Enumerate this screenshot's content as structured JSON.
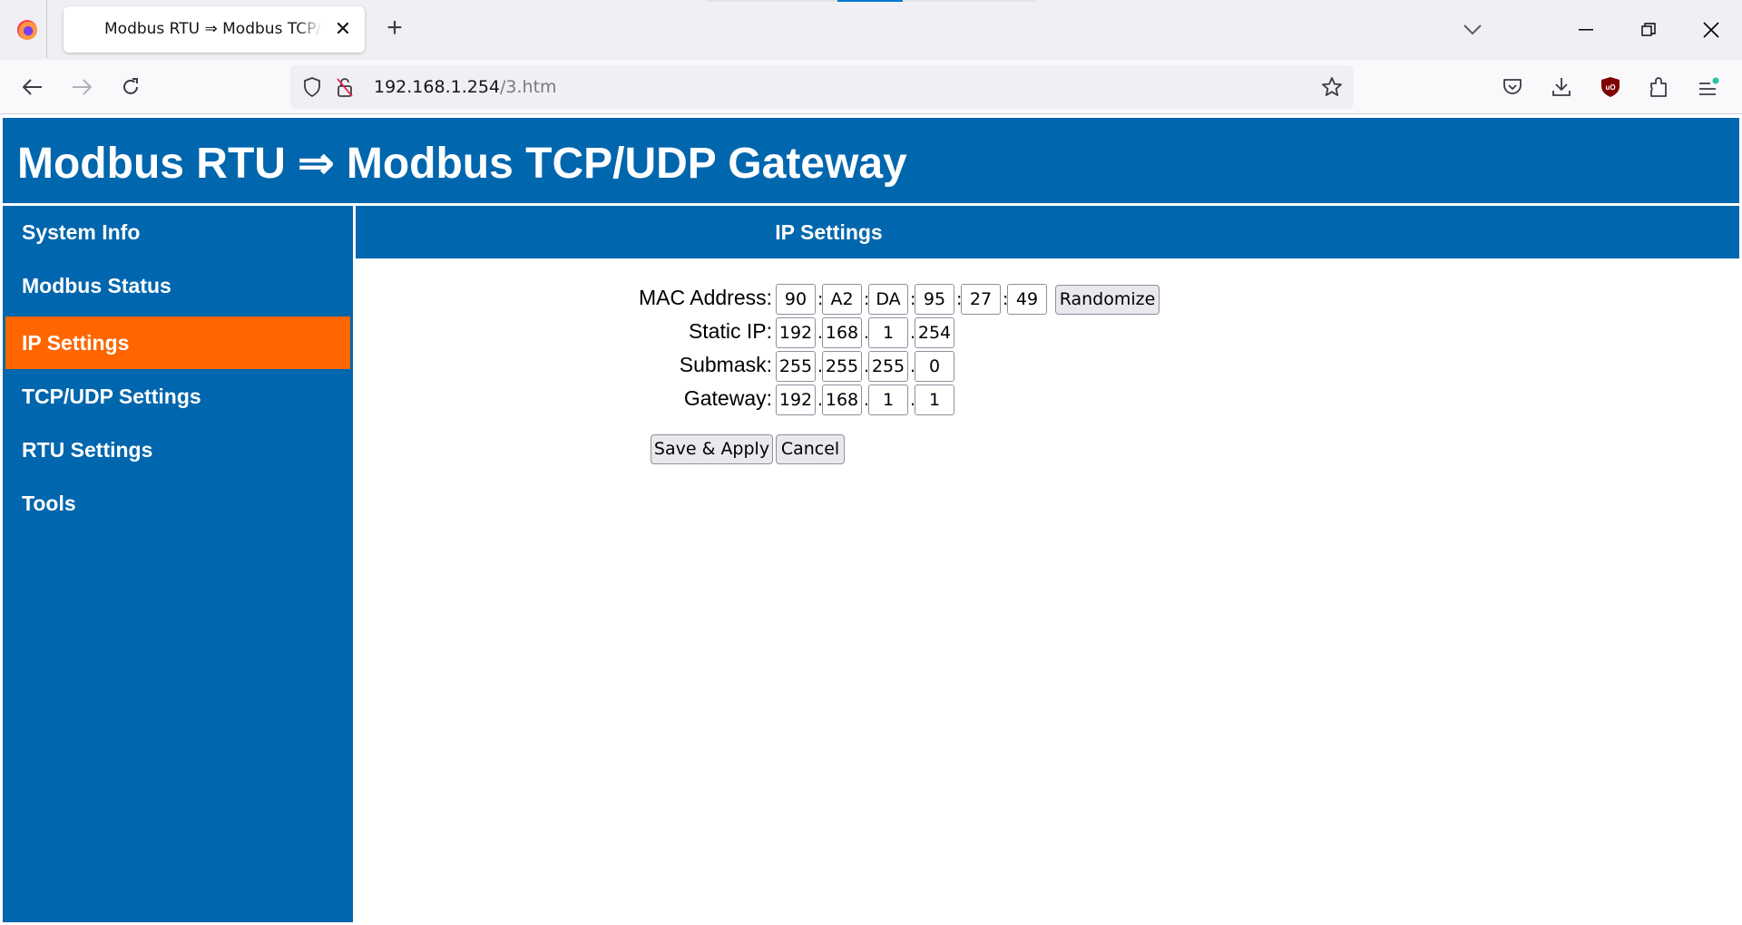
{
  "browser": {
    "tab": {
      "title": "Modbus RTU ⇒ Modbus TCP/UDP Gateway",
      "close_icon": "close-icon"
    },
    "new_tab_icon": "plus-icon",
    "window_controls": [
      "chevron-down-icon",
      "minimize-icon",
      "restore-icon",
      "close-icon"
    ],
    "url": {
      "host": "192.168.1.254",
      "path": "/3.htm"
    },
    "toolbar_icons": [
      "pocket-icon",
      "download-icon",
      "ublock-icon",
      "extensions-icon",
      "menu-icon"
    ],
    "colors": {
      "ublock": "#800000",
      "notification_dot": "#2ac3a2",
      "drag_indicator": "#0078d4"
    }
  },
  "page": {
    "title": "Modbus RTU ⇒ Modbus TCP/UDP Gateway",
    "colors": {
      "primary": "#0066ad",
      "active": "#ff6600"
    },
    "sidebar": {
      "items": [
        {
          "label": "System Info",
          "active": false
        },
        {
          "label": "Modbus Status",
          "active": false
        },
        {
          "label": "IP Settings",
          "active": true
        },
        {
          "label": "TCP/UDP Settings",
          "active": false
        },
        {
          "label": "RTU Settings",
          "active": false
        },
        {
          "label": "Tools",
          "active": false
        }
      ]
    },
    "section_title": "IP Settings",
    "form": {
      "mac": {
        "label": "MAC Address:",
        "values": [
          "90",
          "A2",
          "DA",
          "95",
          "27",
          "49"
        ],
        "separator": ":",
        "randomize_label": "Randomize"
      },
      "static_ip": {
        "label": "Static IP:",
        "values": [
          "192",
          "168",
          "1",
          "254"
        ],
        "separator": "."
      },
      "submask": {
        "label": "Submask:",
        "values": [
          "255",
          "255",
          "255",
          "0"
        ],
        "separator": "."
      },
      "gateway": {
        "label": "Gateway:",
        "values": [
          "192",
          "168",
          "1",
          "1"
        ],
        "separator": "."
      },
      "save_label": "Save & Apply",
      "cancel_label": "Cancel"
    }
  }
}
